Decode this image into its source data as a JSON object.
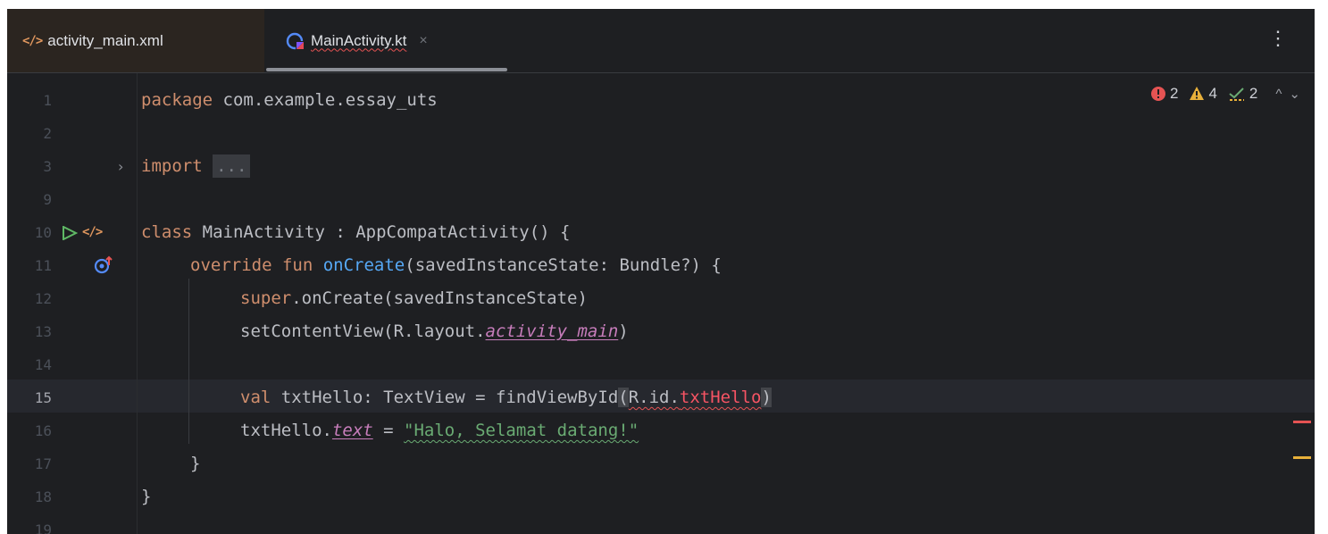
{
  "tabs": [
    {
      "label": "activity_main.xml",
      "icon": "xml-icon",
      "active": false
    },
    {
      "label": "MainActivity.kt",
      "icon": "kotlin-class-icon",
      "active": true,
      "close": "×"
    }
  ],
  "menu": "⋮",
  "inspections": {
    "errors": "2",
    "warnings": "4",
    "weak_warnings": "2",
    "prev": "^",
    "next": "⌄"
  },
  "line_numbers": [
    "1",
    "2",
    "3",
    "9",
    "10",
    "11",
    "12",
    "13",
    "14",
    "15",
    "16",
    "17",
    "18",
    "19"
  ],
  "current_line": "15",
  "code": {
    "l1_kw": "package",
    "l1_rest": " com.example.essay_uts",
    "l3_kw": "import",
    "l3_fold": "...",
    "l10_kw": "class",
    "l10_rest": " MainActivity : AppCompatActivity() {",
    "l11_kw": "override fun",
    "l11_fn": "onCreate",
    "l11_rest": "(savedInstanceState: Bundle?) {",
    "l12_kw": "super",
    "l12_rest": ".onCreate(savedInstanceState)",
    "l13_a": "setContentView(R.layout.",
    "l13_b": "activity_main",
    "l13_c": ")",
    "l15_kw": "val",
    "l15_a": " txtHello: TextView = findViewById",
    "l15_b": "(",
    "l15_c": "R.id.",
    "l15_d": "txtHello",
    "l15_e": ")",
    "l16_a": "txtHello.",
    "l16_b": "text",
    "l16_c": " = ",
    "l16_d": "\"Halo, Selamat datang!\"",
    "l17": "}",
    "l18": "}"
  },
  "colors": {
    "background": "#1e1f22",
    "keyword": "#cf8e6d",
    "function": "#56a8f5",
    "string": "#6aab73",
    "property": "#c77dbb",
    "error": "#f75464",
    "warning": "#e8b03a"
  }
}
